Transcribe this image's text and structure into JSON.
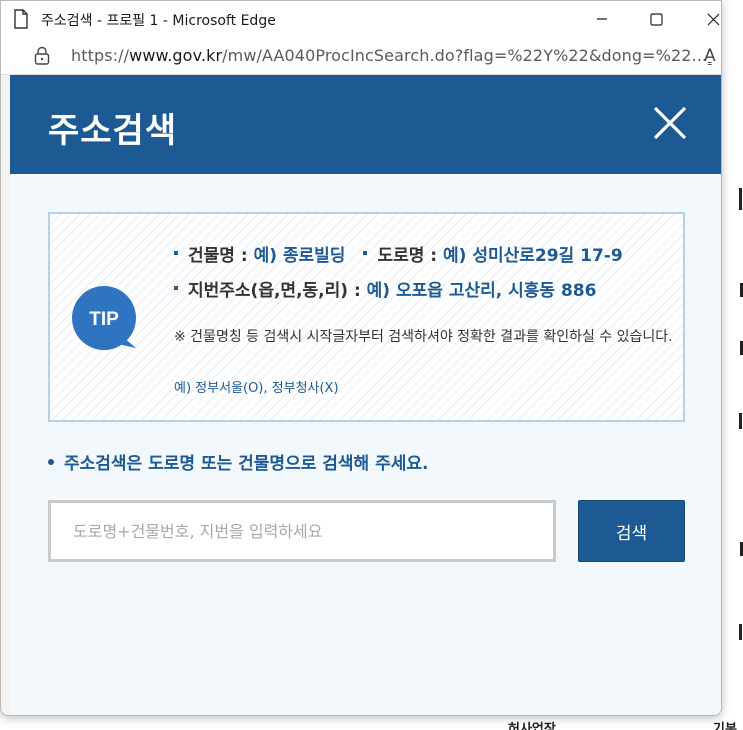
{
  "window": {
    "title": "주소검색 - 프로필 1 - Microsoft Edge",
    "url_prefix": "https://",
    "url_domain": "www.gov.kr",
    "url_rest": "/mw/AA040ProcIncSearch.do?flag=%22Y%22&dong=%22...",
    "read_aloud_glyph": "A͇"
  },
  "popup": {
    "title": "주소검색",
    "tip": {
      "badge": "TIP",
      "line1": {
        "label_a": "건물명 : ",
        "example_a": "예) 종로빌딩",
        "label_b": "도로명 : ",
        "example_b": "예) 성미산로29길 17-9"
      },
      "line2": {
        "label": "지번주소(읍,면,동,리) : ",
        "example": "예) 오포읍 고산리, 시흥동 886"
      },
      "note": "※ 건물명칭 등 검색시 시작글자부터 검색하셔야 정확한 결과를 확인하실 수 있습니다.",
      "note_example": "예) 정부서울(O), 정부청사(X)"
    },
    "guide": "주소검색은 도로명 또는 건물명으로 검색해 주세요.",
    "search": {
      "placeholder": "도로명+건물번호, 지번을 입력하세요",
      "value": "",
      "button_label": "검색"
    }
  },
  "background": {
    "bottom_left_text": "허사업장",
    "bottom_right_text": "기본"
  },
  "colors": {
    "primary": "#1d5a94",
    "tip_badge": "#2f74c0",
    "tip_border": "#b7d1e2"
  }
}
